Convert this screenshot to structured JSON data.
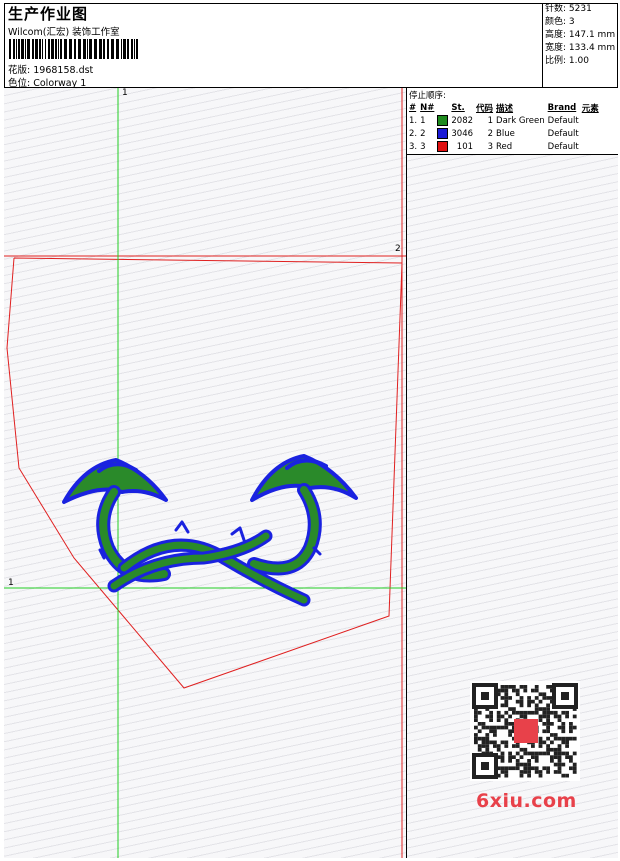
{
  "header": {
    "title": "生产作业图",
    "company": "Wilcom(汇宏) 装饰工作室",
    "design_label": "花版:",
    "design_value": "1968158.dst",
    "colorway_label": "色位:",
    "colorway_value": "Colorway 1"
  },
  "stats": {
    "stitches_label": "针数:",
    "stitches_value": "5231",
    "colors_label": "颜色:",
    "colors_value": "3",
    "height_label": "高度:",
    "height_value": "147.1 mm",
    "width_label": "宽度:",
    "width_value": "133.4 mm",
    "scale_label": "比例:",
    "scale_value": "1.00"
  },
  "stop_sequence": {
    "title": "停止顺序:",
    "columns": [
      "#",
      "N#",
      "St.",
      "代码",
      "描述",
      "Brand",
      "元素"
    ],
    "rows": [
      {
        "idx": "1.",
        "n": "1",
        "swatch": "#1e8a1e",
        "st": "2082",
        "code": "1",
        "desc": "Dark Green",
        "brand": "Default"
      },
      {
        "idx": "2.",
        "n": "2",
        "swatch": "#1a1ad6",
        "st": "3046",
        "code": "2",
        "desc": "Blue",
        "brand": "Default"
      },
      {
        "idx": "3.",
        "n": "3",
        "swatch": "#e01010",
        "st": "101",
        "code": "3",
        "desc": "Red",
        "brand": "Default"
      }
    ]
  },
  "axis_labels": {
    "top": "1",
    "left": "1",
    "right": "2"
  },
  "colors": {
    "guide_green": "#22cc22",
    "outline_red": "#e02020",
    "thread_green": "#2a8a2a",
    "thread_blue": "#1a22e0",
    "watermark": "#e8414a"
  },
  "watermark": "6xiu.com"
}
